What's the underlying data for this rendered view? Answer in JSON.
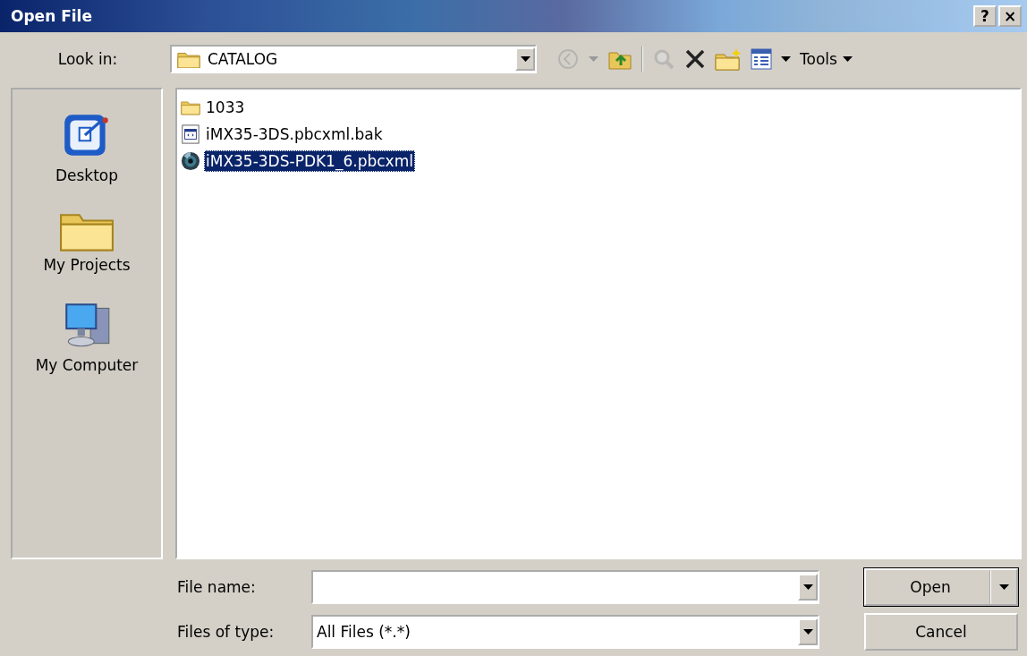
{
  "window": {
    "title": "Open File",
    "buttons": [
      "?",
      "×"
    ]
  },
  "look_in": {
    "label": "Look in:",
    "value": "CATALOG"
  },
  "toolbar": [
    {
      "kind": "back",
      "disabled": true
    },
    {
      "kind": "up",
      "disabled": false
    },
    {
      "kind": "search",
      "disabled": true
    },
    {
      "kind": "delete",
      "disabled": false
    },
    {
      "kind": "new-folder",
      "disabled": false
    },
    {
      "kind": "views",
      "disabled": false
    },
    {
      "kind": "menu",
      "label": "Tools",
      "disabled": false
    }
  ],
  "places": [
    {
      "label": "Desktop",
      "kind": "desktop",
      "selected": false
    },
    {
      "label": "My Projects",
      "kind": "folder",
      "selected": false
    },
    {
      "label": "My Computer",
      "kind": "computer",
      "selected": false
    }
  ],
  "files": [
    {
      "name": "1033",
      "kind": "folder",
      "selected": false
    },
    {
      "name": "iMX35-3DS.pbcxml.bak",
      "kind": "document",
      "selected": false
    },
    {
      "name": "iMX35-3DS-PDK1_6.pbcxml",
      "kind": "project",
      "selected": true
    }
  ],
  "file_name": {
    "label": "File name:"
  },
  "file_type": {
    "label": "Files of type:",
    "value": "All Files (*.*)"
  },
  "buttons": [
    {
      "label": "Open",
      "kind": "split"
    },
    {
      "label": "Cancel",
      "kind": "plain"
    }
  ]
}
